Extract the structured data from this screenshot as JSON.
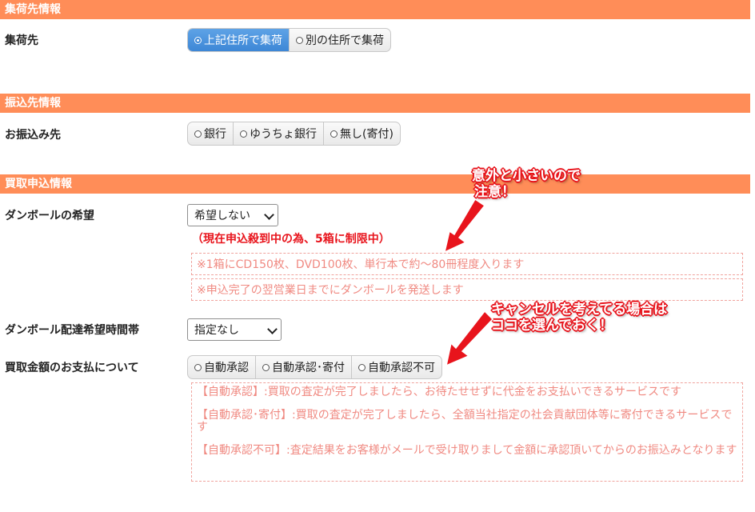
{
  "sections": {
    "pickup": {
      "header": "集荷先情報",
      "label": "集荷先",
      "options": [
        "上記住所で集荷",
        "別の住所で集荷"
      ],
      "selected_index": 0
    },
    "transfer": {
      "header": "振込先情報",
      "label": "お振込み先",
      "options": [
        "銀行",
        "ゆうちょ銀行",
        "無し(寄付)"
      ]
    },
    "purchase": {
      "header": "買取申込情報",
      "box": {
        "label": "ダンボールの希望",
        "value": "希望しない",
        "notice": "（現在申込殺到中の為、5箱に制限中）",
        "note1": "※1箱にCD150枚、DVD100枚、単行本で約～80冊程度入ります",
        "note2": "※申込完了の翌営業日までにダンボールを発送します"
      },
      "delivery": {
        "label": "ダンボール配達希望時間帯",
        "value": "指定なし"
      },
      "payment": {
        "label": "買取金額のお支払について",
        "options": [
          "自動承認",
          "自動承認･寄付",
          "自動承認不可"
        ],
        "desc1": "【自動承認】:買取の査定が完了しましたら、お待たせせずに代金をお支払いできるサービスです",
        "desc2": "【自動承認･寄付】:買取の査定が完了しましたら、全額当社指定の社会貢献団体等に寄付できるサービスです",
        "desc3": "【自動承認不可】:査定結果をお客様がメールで受け取りまして金額に承認頂いてからのお振込みとなります"
      }
    }
  },
  "annotations": {
    "callout1": {
      "line1": "意外と小さいので",
      "line2": "注意！"
    },
    "callout2": {
      "line1": "キャンセルを考えてる場合は",
      "line2": "ココを選んでおく！"
    }
  },
  "colors": {
    "header_bg": "#ff8d58",
    "accent_red": "#e8141c",
    "note_text": "#f08a82",
    "selected_blue": "#3d87d6"
  }
}
